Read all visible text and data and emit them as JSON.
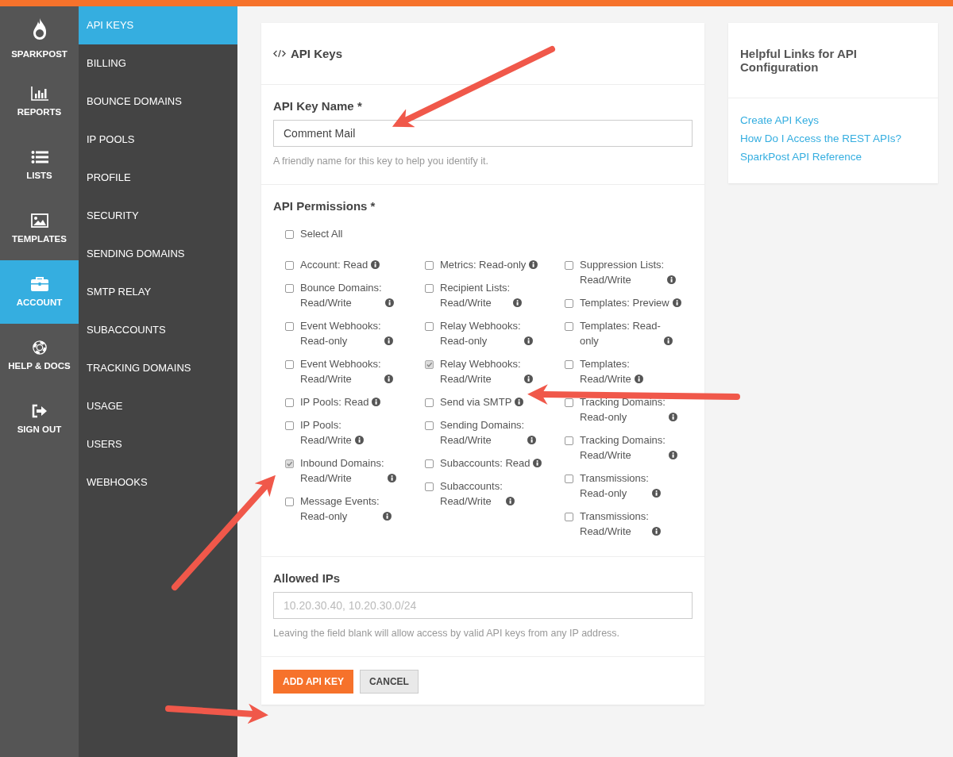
{
  "main_nav": [
    {
      "label": "SPARKPOST",
      "kind": "logo",
      "selected": false
    },
    {
      "label": "REPORTS",
      "kind": "chart",
      "selected": false
    },
    {
      "label": "LISTS",
      "kind": "list",
      "selected": false
    },
    {
      "label": "TEMPLATES",
      "kind": "image",
      "selected": false
    },
    {
      "label": "ACCOUNT",
      "kind": "briefcase",
      "selected": true
    },
    {
      "label": "HELP & DOCS",
      "kind": "lifebuoy",
      "selected": false
    },
    {
      "label": "SIGN OUT",
      "kind": "signout",
      "selected": false
    }
  ],
  "sub_nav": [
    {
      "label": "API KEYS",
      "selected": true
    },
    {
      "label": "BILLING",
      "selected": false
    },
    {
      "label": "BOUNCE DOMAINS",
      "selected": false
    },
    {
      "label": "IP POOLS",
      "selected": false
    },
    {
      "label": "PROFILE",
      "selected": false
    },
    {
      "label": "SECURITY",
      "selected": false
    },
    {
      "label": "SENDING DOMAINS",
      "selected": false
    },
    {
      "label": "SMTP RELAY",
      "selected": false
    },
    {
      "label": "SUBACCOUNTS",
      "selected": false
    },
    {
      "label": "TRACKING DOMAINS",
      "selected": false
    },
    {
      "label": "USAGE",
      "selected": false
    },
    {
      "label": "USERS",
      "selected": false
    },
    {
      "label": "WEBHOOKS",
      "selected": false
    }
  ],
  "form": {
    "title": "API Keys",
    "name_label": "API Key Name *",
    "name_value": "Comment Mail",
    "name_help": "A friendly name for this key to help you identify it.",
    "permissions_label": "API Permissions *",
    "select_all": {
      "label": "Select All",
      "checked": false
    },
    "permission_columns": [
      [
        {
          "label": "Account: Read",
          "checked": false
        },
        {
          "label": "Bounce Domains:\nRead/Write",
          "checked": false
        },
        {
          "label": "Event Webhooks:\nRead-only",
          "checked": false
        },
        {
          "label": "Event Webhooks:\nRead/Write",
          "checked": false
        },
        {
          "label": "IP Pools: Read",
          "checked": false
        },
        {
          "label": "IP Pools:\nRead/Write",
          "checked": false
        },
        {
          "label": "Inbound Domains:\nRead/Write",
          "checked": true
        },
        {
          "label": "Message Events:\nRead-only",
          "checked": false
        }
      ],
      [
        {
          "label": "Metrics: Read-only",
          "checked": false
        },
        {
          "label": "Recipient Lists:\nRead/Write",
          "checked": false
        },
        {
          "label": "Relay Webhooks:\nRead-only",
          "checked": false
        },
        {
          "label": "Relay Webhooks:\nRead/Write",
          "checked": true
        },
        {
          "label": "Send via SMTP",
          "checked": false
        },
        {
          "label": "Sending Domains:\nRead/Write",
          "checked": false
        },
        {
          "label": "Subaccounts: Read",
          "checked": false
        },
        {
          "label": "Subaccounts:\nRead/Write",
          "checked": false
        }
      ],
      [
        {
          "label": "Suppression Lists:\nRead/Write",
          "checked": false
        },
        {
          "label": "Templates: Preview",
          "checked": false
        },
        {
          "label": "Templates: Read-\nonly",
          "checked": false
        },
        {
          "label": "Templates:\nRead/Write",
          "checked": false
        },
        {
          "label": "Tracking Domains:\nRead-only",
          "checked": false
        },
        {
          "label": "Tracking Domains:\nRead/Write",
          "checked": false
        },
        {
          "label": "Transmissions:\nRead-only",
          "checked": false
        },
        {
          "label": "Transmissions:\nRead/Write",
          "checked": false
        }
      ]
    ],
    "ips_label": "Allowed IPs",
    "ips_placeholder": "10.20.30.40, 10.20.30.0/24",
    "ips_help": "Leaving the field blank will allow access by valid API keys from any IP address.",
    "submit": "ADD API KEY",
    "cancel": "CANCEL"
  },
  "help_panel": {
    "title": "Helpful Links for API Configuration",
    "links": [
      "Create API Keys",
      "How Do I Access the REST APIs?",
      "SparkPost API Reference"
    ]
  }
}
